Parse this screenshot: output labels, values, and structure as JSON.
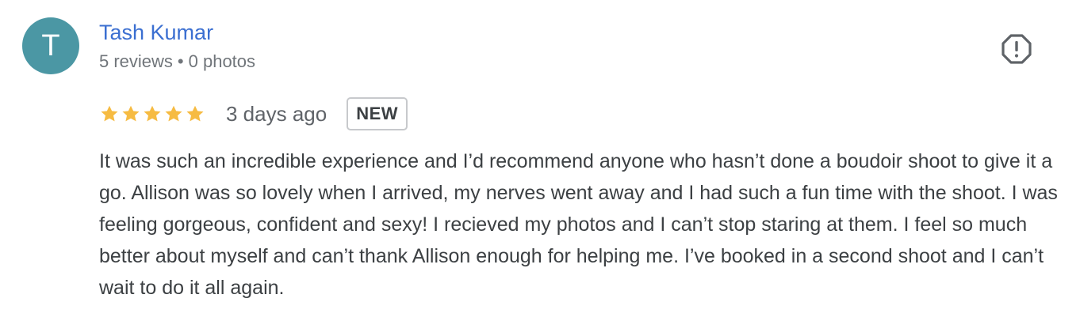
{
  "review": {
    "author": {
      "initial": "T",
      "name": "Tash Kumar",
      "reviews": "5 reviews",
      "separator": "•",
      "photos": "0 photos",
      "avatar_color": "#4b97a4"
    },
    "rating": 5,
    "time": "3 days ago",
    "badge": "NEW",
    "text": "It was such an incredible experience and I’d recommend anyone who hasn’t done a boudoir shoot to give it a go. Allison was so lovely when I arrived, my nerves went away and I had such a fun time with the shoot. I was feeling gorgeous, confident and sexy! I recieved my photos and I can’t stop staring at them. I feel so much better about myself and can’t thank Allison enough for helping me. I’ve booked in a second shoot and I can’t wait to do it all again.",
    "report_icon": "report-icon",
    "star_color": "#f6bb42"
  }
}
